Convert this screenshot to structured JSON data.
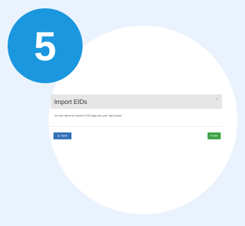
{
  "step": {
    "number": "5"
  },
  "modal": {
    "title": "Import EIDs",
    "close_symbol": "×",
    "body_text": "You are about to import 5 EID tags into your tag bucket.",
    "back_label": "Back",
    "back_icon": "chevron-left-icon",
    "finish_label": "Finish"
  },
  "colors": {
    "background": "#eaf3fd",
    "badge": "#1a97df",
    "back_button": "#3473b8",
    "finish_button": "#3ea446",
    "header": "#e6e6e6"
  }
}
